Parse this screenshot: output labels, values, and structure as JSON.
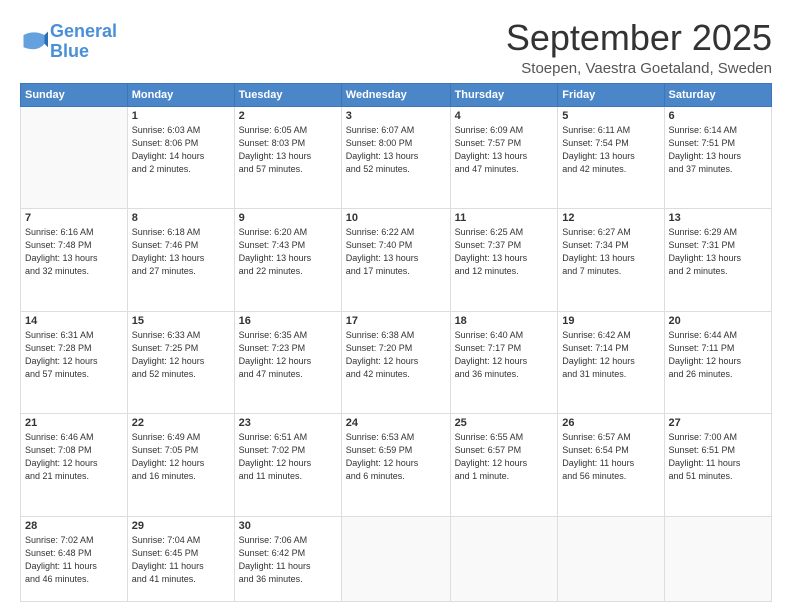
{
  "logo": {
    "line1": "General",
    "line2": "Blue"
  },
  "title": "September 2025",
  "location": "Stoepen, Vaestra Goetaland, Sweden",
  "days_header": [
    "Sunday",
    "Monday",
    "Tuesday",
    "Wednesday",
    "Thursday",
    "Friday",
    "Saturday"
  ],
  "weeks": [
    [
      {
        "day": "",
        "info": ""
      },
      {
        "day": "1",
        "info": "Sunrise: 6:03 AM\nSunset: 8:06 PM\nDaylight: 14 hours\nand 2 minutes."
      },
      {
        "day": "2",
        "info": "Sunrise: 6:05 AM\nSunset: 8:03 PM\nDaylight: 13 hours\nand 57 minutes."
      },
      {
        "day": "3",
        "info": "Sunrise: 6:07 AM\nSunset: 8:00 PM\nDaylight: 13 hours\nand 52 minutes."
      },
      {
        "day": "4",
        "info": "Sunrise: 6:09 AM\nSunset: 7:57 PM\nDaylight: 13 hours\nand 47 minutes."
      },
      {
        "day": "5",
        "info": "Sunrise: 6:11 AM\nSunset: 7:54 PM\nDaylight: 13 hours\nand 42 minutes."
      },
      {
        "day": "6",
        "info": "Sunrise: 6:14 AM\nSunset: 7:51 PM\nDaylight: 13 hours\nand 37 minutes."
      }
    ],
    [
      {
        "day": "7",
        "info": "Sunrise: 6:16 AM\nSunset: 7:48 PM\nDaylight: 13 hours\nand 32 minutes."
      },
      {
        "day": "8",
        "info": "Sunrise: 6:18 AM\nSunset: 7:46 PM\nDaylight: 13 hours\nand 27 minutes."
      },
      {
        "day": "9",
        "info": "Sunrise: 6:20 AM\nSunset: 7:43 PM\nDaylight: 13 hours\nand 22 minutes."
      },
      {
        "day": "10",
        "info": "Sunrise: 6:22 AM\nSunset: 7:40 PM\nDaylight: 13 hours\nand 17 minutes."
      },
      {
        "day": "11",
        "info": "Sunrise: 6:25 AM\nSunset: 7:37 PM\nDaylight: 13 hours\nand 12 minutes."
      },
      {
        "day": "12",
        "info": "Sunrise: 6:27 AM\nSunset: 7:34 PM\nDaylight: 13 hours\nand 7 minutes."
      },
      {
        "day": "13",
        "info": "Sunrise: 6:29 AM\nSunset: 7:31 PM\nDaylight: 13 hours\nand 2 minutes."
      }
    ],
    [
      {
        "day": "14",
        "info": "Sunrise: 6:31 AM\nSunset: 7:28 PM\nDaylight: 12 hours\nand 57 minutes."
      },
      {
        "day": "15",
        "info": "Sunrise: 6:33 AM\nSunset: 7:25 PM\nDaylight: 12 hours\nand 52 minutes."
      },
      {
        "day": "16",
        "info": "Sunrise: 6:35 AM\nSunset: 7:23 PM\nDaylight: 12 hours\nand 47 minutes."
      },
      {
        "day": "17",
        "info": "Sunrise: 6:38 AM\nSunset: 7:20 PM\nDaylight: 12 hours\nand 42 minutes."
      },
      {
        "day": "18",
        "info": "Sunrise: 6:40 AM\nSunset: 7:17 PM\nDaylight: 12 hours\nand 36 minutes."
      },
      {
        "day": "19",
        "info": "Sunrise: 6:42 AM\nSunset: 7:14 PM\nDaylight: 12 hours\nand 31 minutes."
      },
      {
        "day": "20",
        "info": "Sunrise: 6:44 AM\nSunset: 7:11 PM\nDaylight: 12 hours\nand 26 minutes."
      }
    ],
    [
      {
        "day": "21",
        "info": "Sunrise: 6:46 AM\nSunset: 7:08 PM\nDaylight: 12 hours\nand 21 minutes."
      },
      {
        "day": "22",
        "info": "Sunrise: 6:49 AM\nSunset: 7:05 PM\nDaylight: 12 hours\nand 16 minutes."
      },
      {
        "day": "23",
        "info": "Sunrise: 6:51 AM\nSunset: 7:02 PM\nDaylight: 12 hours\nand 11 minutes."
      },
      {
        "day": "24",
        "info": "Sunrise: 6:53 AM\nSunset: 6:59 PM\nDaylight: 12 hours\nand 6 minutes."
      },
      {
        "day": "25",
        "info": "Sunrise: 6:55 AM\nSunset: 6:57 PM\nDaylight: 12 hours\nand 1 minute."
      },
      {
        "day": "26",
        "info": "Sunrise: 6:57 AM\nSunset: 6:54 PM\nDaylight: 11 hours\nand 56 minutes."
      },
      {
        "day": "27",
        "info": "Sunrise: 7:00 AM\nSunset: 6:51 PM\nDaylight: 11 hours\nand 51 minutes."
      }
    ],
    [
      {
        "day": "28",
        "info": "Sunrise: 7:02 AM\nSunset: 6:48 PM\nDaylight: 11 hours\nand 46 minutes."
      },
      {
        "day": "29",
        "info": "Sunrise: 7:04 AM\nSunset: 6:45 PM\nDaylight: 11 hours\nand 41 minutes."
      },
      {
        "day": "30",
        "info": "Sunrise: 7:06 AM\nSunset: 6:42 PM\nDaylight: 11 hours\nand 36 minutes."
      },
      {
        "day": "",
        "info": ""
      },
      {
        "day": "",
        "info": ""
      },
      {
        "day": "",
        "info": ""
      },
      {
        "day": "",
        "info": ""
      }
    ]
  ]
}
